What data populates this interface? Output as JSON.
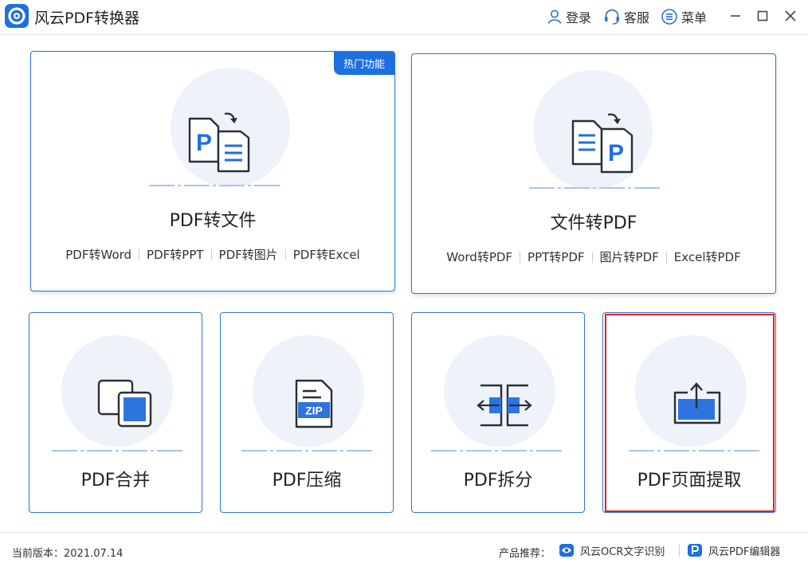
{
  "app": {
    "title": "风云PDF转换器",
    "accent_color": "#1f6fe0",
    "logo_icon": "app-logo-icon"
  },
  "header": {
    "login_label": "登录",
    "service_label": "客服",
    "menu_label": "菜单"
  },
  "cards": {
    "pdf_to_file": {
      "title": "PDF转文件",
      "badge": "热门功能",
      "options": [
        "PDF转Word",
        "PDF转PPT",
        "PDF转图片",
        "PDF转Excel"
      ]
    },
    "file_to_pdf": {
      "title": "文件转PDF",
      "options": [
        "Word转PDF",
        "PPT转PDF",
        "图片转PDF",
        "Excel转PDF"
      ]
    },
    "merge": {
      "title": "PDF合并"
    },
    "compress": {
      "title": "PDF压缩",
      "icon_text": "ZIP"
    },
    "split": {
      "title": "PDF拆分"
    },
    "extract": {
      "title": "PDF页面提取",
      "highlight_color": "#e02020"
    }
  },
  "footer": {
    "version": "当前版本：2021.07.14",
    "recommend_label": "产品推荐：",
    "ocr_label": "风云OCR文字识别",
    "editor_label": "风云PDF编辑器"
  }
}
